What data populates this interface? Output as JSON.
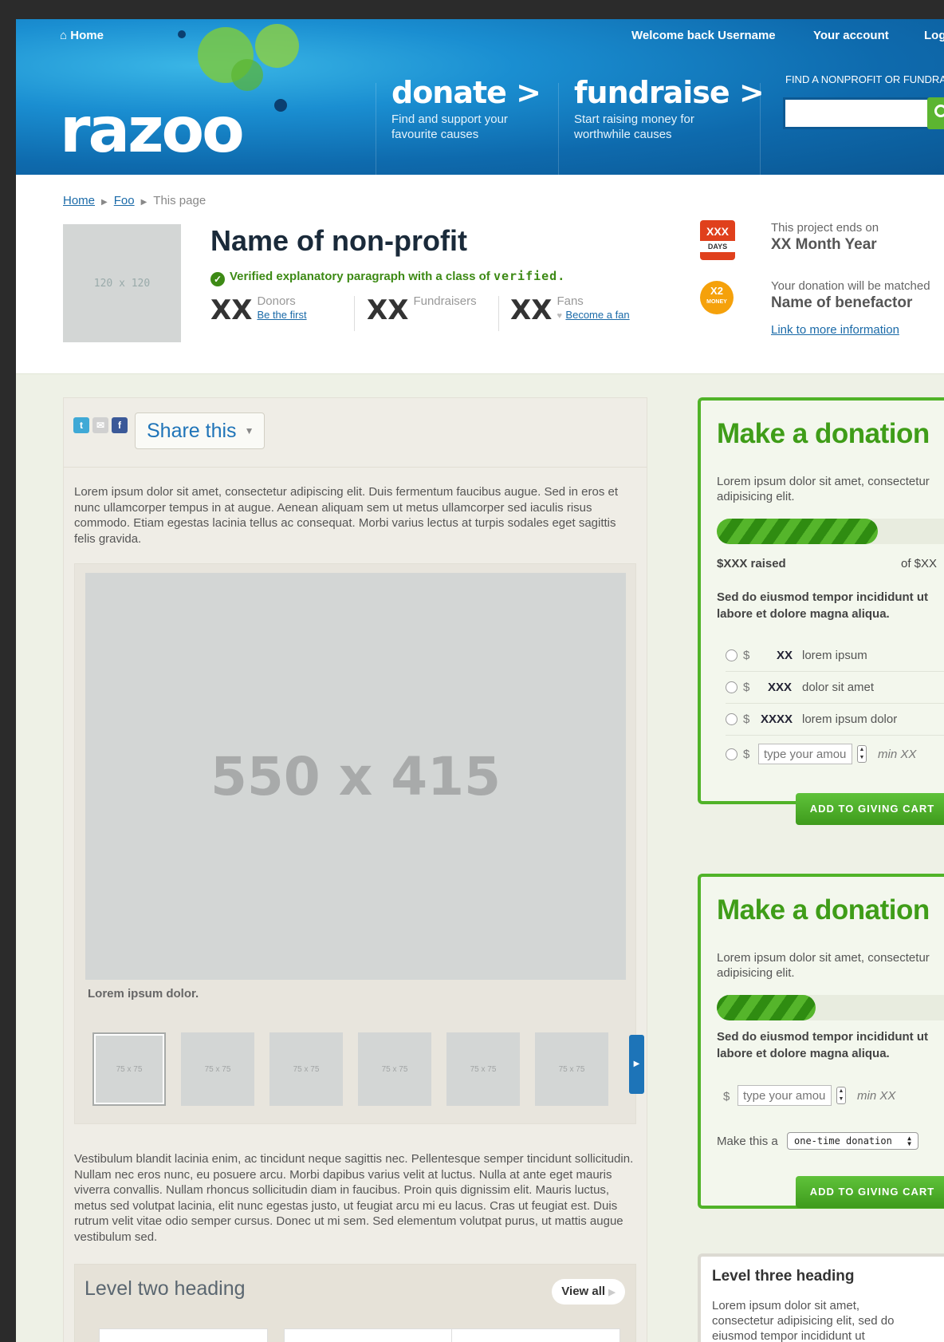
{
  "header": {
    "home_label": "Home",
    "welcome_prefix": "Welcome back ",
    "username": "Username",
    "account_label": "Your account",
    "logout_label": "Log",
    "logo_text": "razoo",
    "donate": {
      "title": "donate >",
      "sub1": "Find and support your",
      "sub2": "favourite causes"
    },
    "fundraise": {
      "title": "fundraise >",
      "sub1": "Start raising money for",
      "sub2": "worthwhile causes"
    },
    "find_label": "FIND A NONPROFIT OR FUNDRA",
    "search_value": ""
  },
  "breadcrumb": {
    "home": "Home",
    "foo": "Foo",
    "current": "This page"
  },
  "profile": {
    "image_placeholder": "120 x 120",
    "name": "Name of non-profit",
    "verified_text": "Verified explanatory paragraph with a class of ",
    "verified_code": "verified.",
    "donors": {
      "count": "XX",
      "label": "Donors",
      "link": "Be the first"
    },
    "fundraisers": {
      "count": "XX",
      "label": "Fundraisers"
    },
    "fans": {
      "count": "XX",
      "label": "Fans",
      "link": "Become a fan"
    },
    "days_badge": {
      "top": "XXX",
      "bottom": "DAYS"
    },
    "x2_badge": {
      "top": "X2",
      "bottom": "MONEY"
    },
    "ends_label": "This project ends on",
    "ends_value": "XX Month Year",
    "match_label": "Your donation will be matched",
    "match_value": "Name of benefactor",
    "more_link": "Link to more information"
  },
  "main": {
    "share_label": "Share this",
    "intro": "Lorem ipsum dolor sit amet, consectetur adipiscing elit. Duis fermentum faucibus augue. Sed in eros et nunc ullamcorper tempus in at augue. Aenean aliquam sem ut metus ullamcorper sed iaculis risus commodo. Etiam egestas lacinia tellus ac consequat. Morbi varius lectus at turpis sodales eget sagittis felis gravida.",
    "main_image": "550 x 415",
    "caption": "Lorem ipsum dolor.",
    "thumbs": [
      "75 x 75",
      "75 x 75",
      "75 x 75",
      "75 x 75",
      "75 x 75",
      "75 x 75"
    ],
    "body": "Vestibulum blandit lacinia enim, ac tincidunt neque sagittis nec. Pellentesque semper tincidunt sollicitudin. Nullam nec eros nunc, eu posuere arcu. Morbi dapibus varius velit at luctus. Nulla at ante eget mauris viverra convallis. Nullam rhoncus sollicitudin diam in faucibus. Proin quis dignissim elit. Mauris luctus, metus sed volutpat lacinia, elit nunc egestas justo, ut feugiat arcu mi eu lacus. Cras ut feugiat est. Duis rutrum velit vitae odio semper cursus. Donec ut mi sem. Sed elementum volutpat purus, ut mattis augue vestibulum sed.",
    "level_two_heading": "Level two heading",
    "view_all": "View all"
  },
  "donation1": {
    "title": "Make a donation",
    "lead": "Lorem ipsum dolor sit amet, consectetur adipisicing elit.",
    "progress_fraction": 0.65,
    "raised": "$XXX raised",
    "of": "of $XX",
    "note": "Sed do eiusmod tempor incididunt ut labore et dolore magna aliqua.",
    "options": [
      {
        "currency": "$",
        "amount": "XX",
        "desc": "lorem ipsum"
      },
      {
        "currency": "$",
        "amount": "XXX",
        "desc": "dolor sit amet"
      },
      {
        "currency": "$",
        "amount": "XXXX",
        "desc": "lorem ipsum dolor"
      }
    ],
    "custom_currency": "$",
    "amount_placeholder": "type your amount",
    "min": "min XX",
    "button": "ADD TO GIVING CART"
  },
  "donation2": {
    "title": "Make a donation",
    "lead": "Lorem ipsum dolor sit amet, consectetur adipisicing elit.",
    "progress_fraction": 0.4,
    "note": "Sed do eiusmod tempor incididunt ut labore et dolore magna aliqua.",
    "currency": "$",
    "amount_placeholder": "type your amount",
    "min": "min XX",
    "frequency_label": "Make this a",
    "frequency_value": "one-time donation",
    "button": "ADD TO GIVING CART"
  },
  "level_three": {
    "heading": "Level three heading",
    "text": "Lorem ipsum dolor sit amet, consectetur adipisicing elit, sed do eiusmod tempor incididunt ut labore et"
  },
  "colors": {
    "brand_blue": "#1a8ed1",
    "brand_green": "#50b328",
    "link": "#1a6aa8",
    "verified_green": "#3d8a15"
  }
}
